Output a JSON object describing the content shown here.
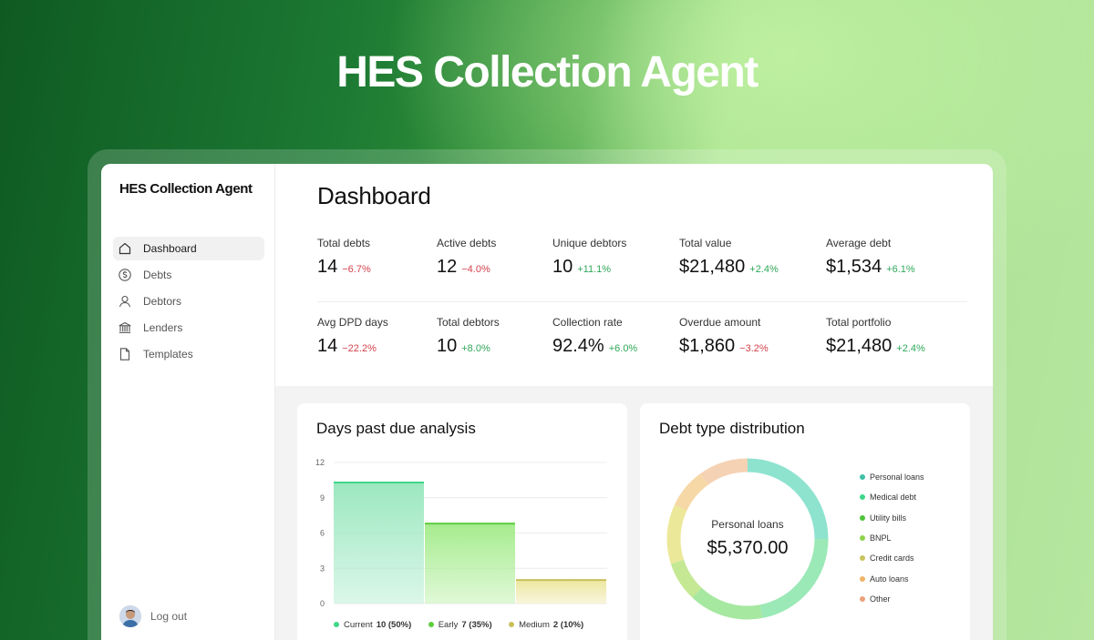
{
  "hero": {
    "title": "HES Collection Agent"
  },
  "sidebar": {
    "brand": "HES Collection Agent",
    "items": [
      {
        "label": "Dashboard",
        "icon": "home-icon",
        "active": true
      },
      {
        "label": "Debts",
        "icon": "dollar-circle-icon",
        "active": false
      },
      {
        "label": "Debtors",
        "icon": "user-icon",
        "active": false
      },
      {
        "label": "Lenders",
        "icon": "bank-icon",
        "active": false
      },
      {
        "label": "Templates",
        "icon": "document-icon",
        "active": false
      }
    ],
    "logout_label": "Log out"
  },
  "main": {
    "title": "Dashboard",
    "stats_row1": [
      {
        "label": "Total debts",
        "value": "14",
        "delta": "−6.7%",
        "trend": "neg"
      },
      {
        "label": "Active debts",
        "value": "12",
        "delta": "−4.0%",
        "trend": "neg"
      },
      {
        "label": "Unique debtors",
        "value": "10",
        "delta": "+11.1%",
        "trend": "pos"
      },
      {
        "label": "Total value",
        "value": "$21,480",
        "delta": "+2.4%",
        "trend": "pos"
      },
      {
        "label": "Average debt",
        "value": "$1,534",
        "delta": "+6.1%",
        "trend": "pos"
      }
    ],
    "stats_row2": [
      {
        "label": "Avg DPD days",
        "value": "14",
        "delta": "−22.2%",
        "trend": "neg"
      },
      {
        "label": "Total debtors",
        "value": "10",
        "delta": "+8.0%",
        "trend": "pos"
      },
      {
        "label": "Collection rate",
        "value": "92.4%",
        "delta": "+6.0%",
        "trend": "pos"
      },
      {
        "label": "Overdue amount",
        "value": "$1,860",
        "delta": "−3.2%",
        "trend": "neg"
      },
      {
        "label": "Total portfolio",
        "value": "$21,480",
        "delta": "+2.4%",
        "trend": "pos"
      }
    ]
  },
  "dpd_card": {
    "title": "Days past due analysis",
    "legend": [
      {
        "label": "Current",
        "count": "10 (50%)",
        "color": "#3fd68a"
      },
      {
        "label": "Early",
        "count": "7 (35%)",
        "color": "#5fcc3f"
      },
      {
        "label": "Medium",
        "count": "2 (10%)",
        "color": "#c8c05a"
      }
    ]
  },
  "dist_card": {
    "title": "Debt type distribution",
    "center_label": "Personal loans",
    "center_value": "$5,370.00",
    "legend": [
      {
        "label": "Personal loans",
        "color": "#3fbfa6"
      },
      {
        "label": "Medical debt",
        "color": "#3fd68a"
      },
      {
        "label": "Utility bills",
        "color": "#4fc43a"
      },
      {
        "label": "BNPL",
        "color": "#8fd24e"
      },
      {
        "label": "Credit cards",
        "color": "#c9c45e"
      },
      {
        "label": "Auto loans",
        "color": "#f2b36a"
      },
      {
        "label": "Other",
        "color": "#eba27a"
      }
    ]
  },
  "chart_data": [
    {
      "type": "bar",
      "title": "Days past due analysis",
      "categories": [
        "Current",
        "Early",
        "Medium"
      ],
      "values": [
        10.3,
        6.8,
        2.0
      ],
      "ylim": [
        0,
        12
      ],
      "yticks": [
        "0",
        "3",
        "6",
        "9",
        "12"
      ],
      "grid": true,
      "colors": [
        "#9be8c0",
        "#a6ec8e",
        "#ede6a0"
      ],
      "edge_colors": [
        "#3fd68a",
        "#5fcc3f",
        "#c8c05a"
      ]
    },
    {
      "type": "pie",
      "title": "Debt type distribution",
      "labels": [
        "Personal loans",
        "Medical debt",
        "Utility bills",
        "BNPL",
        "Credit cards",
        "Auto loans",
        "Other"
      ],
      "values": [
        25,
        22,
        15,
        8,
        12,
        8,
        10
      ],
      "colors": [
        "#8ee3cf",
        "#9ae9b6",
        "#a6e8a0",
        "#c4e894",
        "#ece89a",
        "#f6d7a6",
        "#f6d2b4"
      ],
      "hole": true
    }
  ]
}
